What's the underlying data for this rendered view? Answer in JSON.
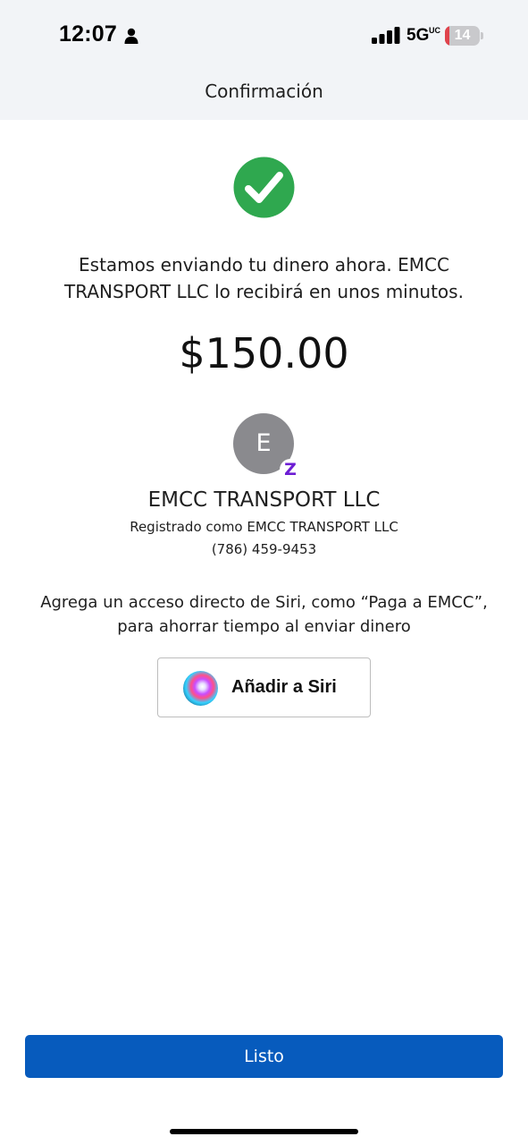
{
  "status_bar": {
    "time": "12:07",
    "network": "5G",
    "network_sub": "UC",
    "battery_level": "14",
    "battery_fraction": 0.14,
    "battery_color": "#e0434c"
  },
  "header": {
    "title": "Confirmación"
  },
  "confirmation": {
    "message": "Estamos enviando tu dinero ahora. EMCC TRANSPORT LLC lo recibirá en unos minutos.",
    "amount": "$150.00",
    "success_color": "#2fa84f"
  },
  "recipient": {
    "initial": "E",
    "badge": "Z",
    "name": "EMCC TRANSPORT LLC",
    "registered_as": "Registrado como EMCC TRANSPORT LLC",
    "phone": "(786) 459-9453"
  },
  "siri": {
    "prompt": "Agrega un acceso directo de Siri, como “Paga a EMCC”, para ahorrar tiempo al enviar dinero",
    "button_label": "Añadir a Siri"
  },
  "footer": {
    "done_label": "Listo",
    "accent": "#075bbd"
  }
}
